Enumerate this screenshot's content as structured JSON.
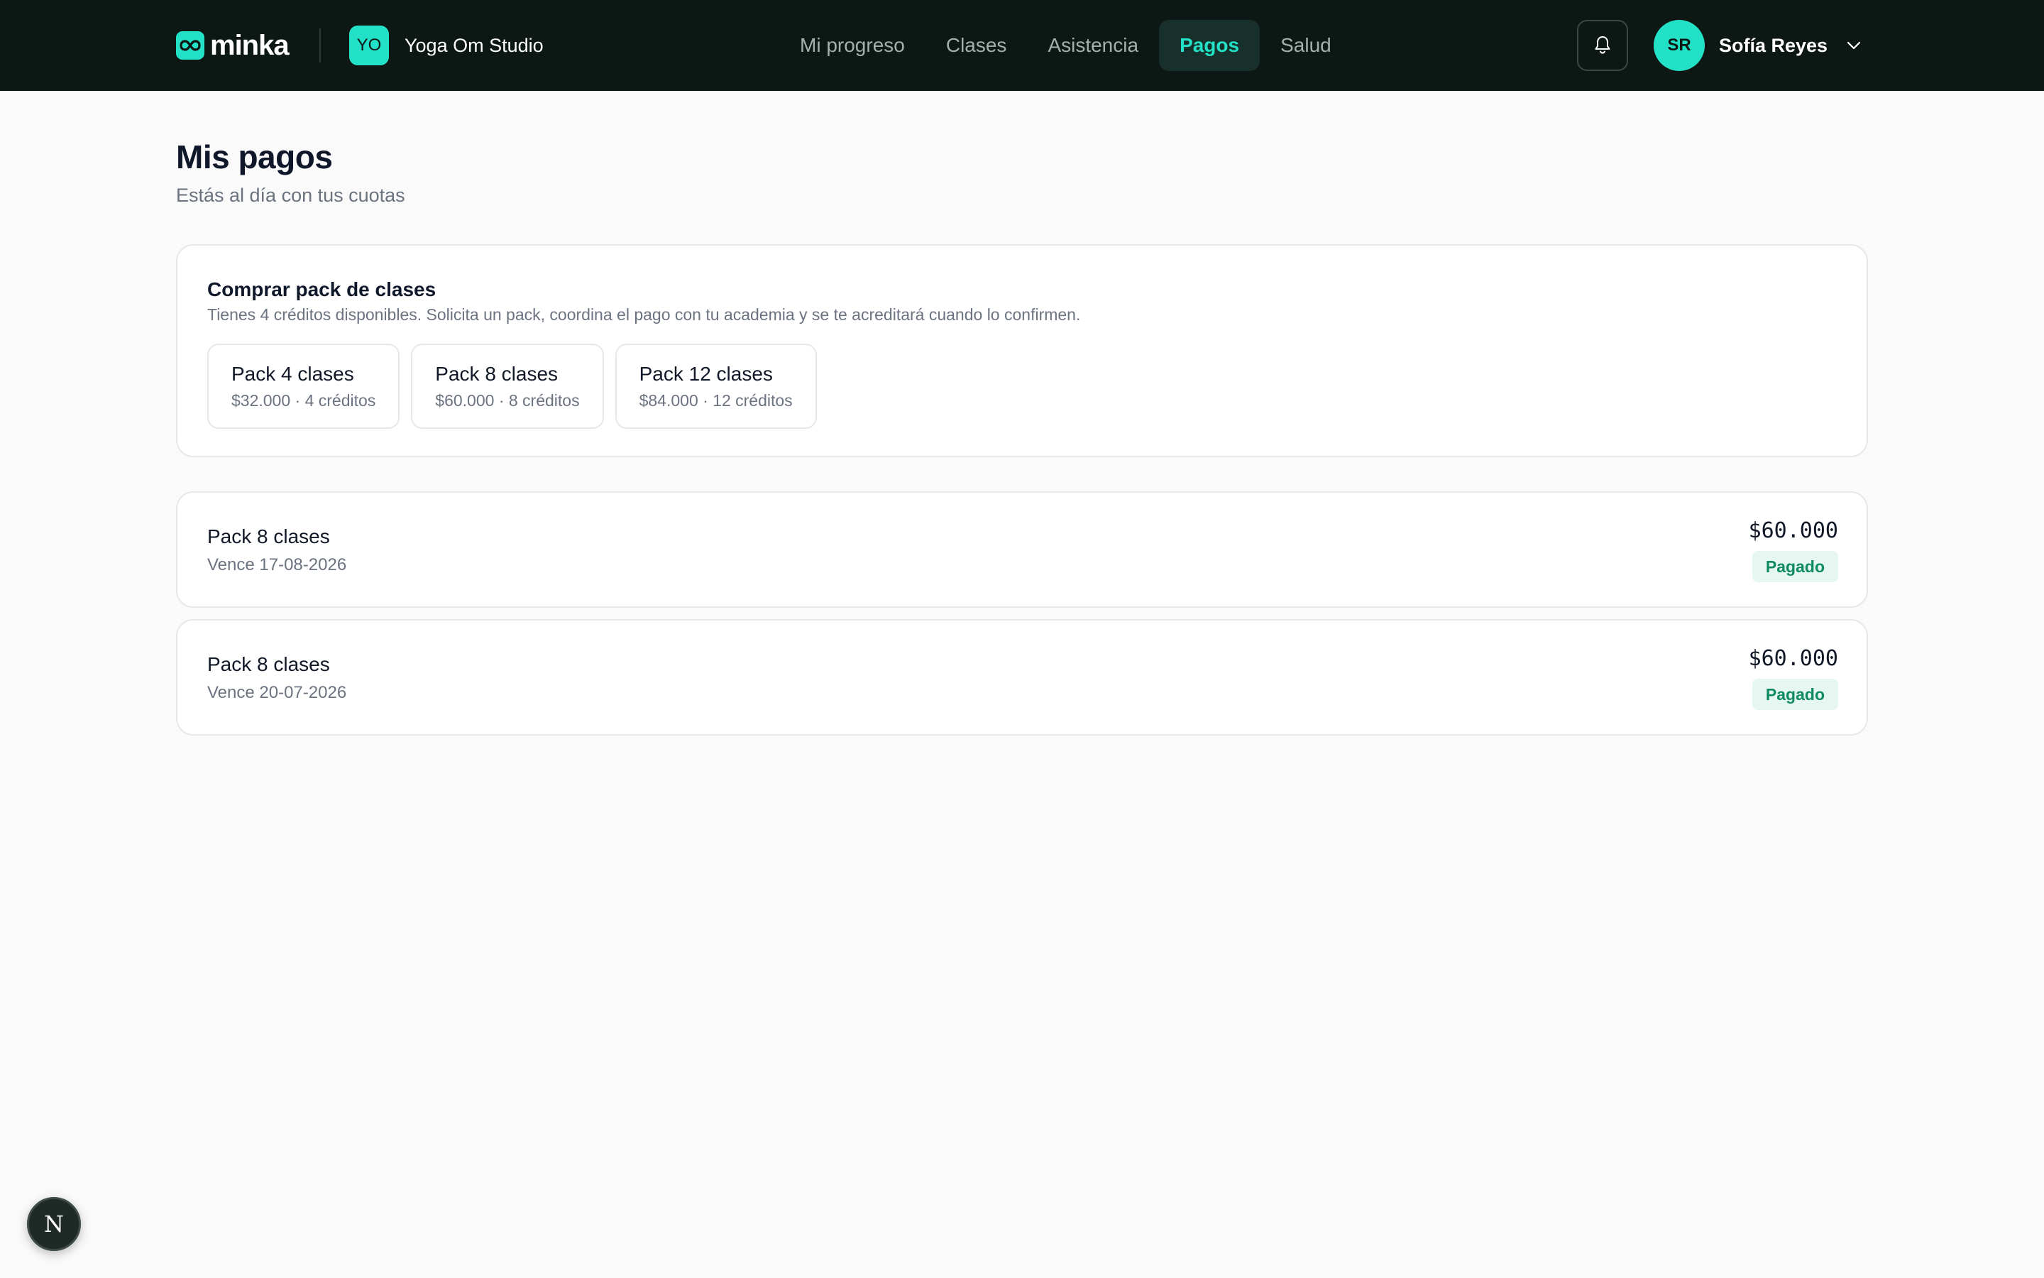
{
  "brand": {
    "name": "minka",
    "icon": "infinity-logo-icon",
    "accent": "#22e1c6"
  },
  "studio": {
    "initials": "YO",
    "name": "Yoga Om Studio"
  },
  "nav": {
    "items": [
      {
        "label": "Mi progreso"
      },
      {
        "label": "Clases"
      },
      {
        "label": "Asistencia"
      },
      {
        "label": "Pagos",
        "active": true
      },
      {
        "label": "Salud"
      }
    ]
  },
  "header_actions": {
    "notifications_icon": "bell-icon"
  },
  "user": {
    "initials": "SR",
    "name": "Sofía Reyes",
    "menu_icon": "chevron-down-icon"
  },
  "page": {
    "title": "Mis pagos",
    "subtitle": "Estás al día con tus cuotas"
  },
  "buy": {
    "title": "Comprar pack de clases",
    "description": "Tienes 4 créditos disponibles. Solicita un pack, coordina el pago con tu academia y se te acreditará cuando lo confirmen.",
    "packs": [
      {
        "name": "Pack 4 clases",
        "meta": "$32.000 · 4 créditos"
      },
      {
        "name": "Pack 8 clases",
        "meta": "$60.000 · 8 créditos"
      },
      {
        "name": "Pack 12 clases",
        "meta": "$84.000 · 12 créditos"
      }
    ]
  },
  "payments": [
    {
      "name": "Pack 8 clases",
      "due": "Vence 17-08-2026",
      "amount": "$60.000",
      "status": "Pagado"
    },
    {
      "name": "Pack 8 clases",
      "due": "Vence 20-07-2026",
      "amount": "$60.000",
      "status": "Pagado"
    }
  ],
  "dev_tools": {
    "label": "N"
  }
}
